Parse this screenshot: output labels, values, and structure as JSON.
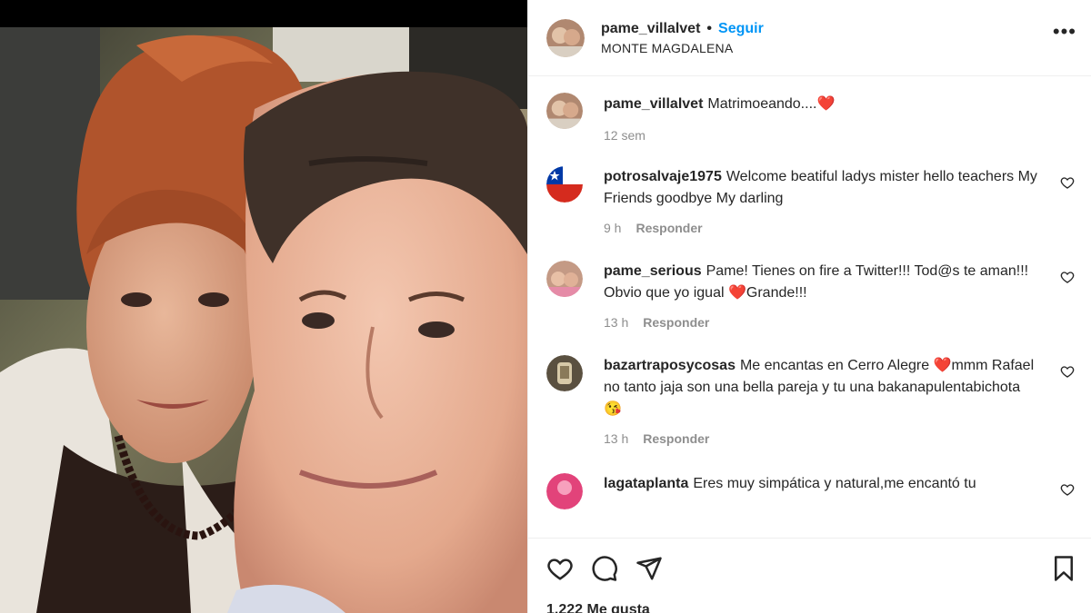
{
  "post": {
    "author": "pame_villalvet",
    "follow_label": "Seguir",
    "separator": "•",
    "location": "MONTE MAGDALENA",
    "more_icon": "more-horizontal-icon"
  },
  "caption": {
    "user": "pame_villalvet",
    "text": "Matrimoeando....❤️",
    "time": "12 sem"
  },
  "comments": [
    {
      "user": "potrosalvaje1975",
      "text": "Welcome beatiful ladys mister hello teachers My Friends goodbye My darling",
      "time": "9 h",
      "reply": "Responder"
    },
    {
      "user": "pame_serious",
      "text": "Pame! Tienes on fire a Twitter!!! Tod@s te aman!!! Obvio que yo igual ❤️Grande!!!",
      "time": "13 h",
      "reply": "Responder"
    },
    {
      "user": "bazartraposycosas",
      "text": "Me encantas en Cerro Alegre ❤️mmm Rafael no tanto jaja son una bella pareja y tu una bakanapulentabichota 😘",
      "time": "13 h",
      "reply": "Responder"
    },
    {
      "user": "lagataplanta",
      "text": "Eres muy simpática y natural,me encantó tu",
      "time": "",
      "reply": ""
    }
  ],
  "actions": {
    "like_icon": "heart-icon",
    "comment_icon": "comment-icon",
    "share_icon": "send-icon",
    "save_icon": "bookmark-icon",
    "likes_text": "1.222 Me gusta"
  },
  "colors": {
    "accent": "#0095f6",
    "muted": "#8e8e8e",
    "text": "#262626",
    "border": "#efefef"
  }
}
